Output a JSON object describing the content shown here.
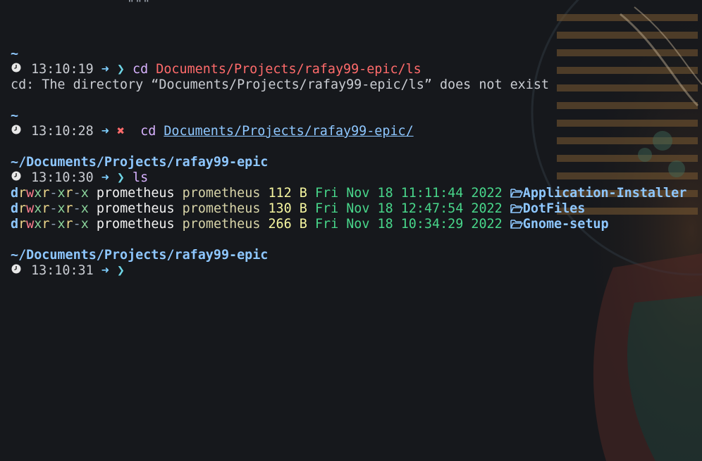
{
  "top_fragment": "\"\"\"",
  "blocks": [
    {
      "dir": "~",
      "time": "13:10:19",
      "status_ok": true,
      "command": "cd",
      "arg": "Documents/Projects/rafay99-epic/ls",
      "output": "cd: The directory “Documents/Projects/rafay99-epic/ls” does not exist"
    },
    {
      "dir": "~",
      "time": "13:10:28",
      "status_ok": false,
      "command": "cd",
      "arg": "Documents/Projects/rafay99-epic/"
    },
    {
      "dir": "~/Documents/Projects/rafay99-epic",
      "time": "13:10:30",
      "status_ok": true,
      "command": "ls",
      "listing": [
        {
          "perm": [
            "d",
            "r",
            "w",
            "x",
            "r",
            "-",
            "x",
            "r",
            "-",
            "x"
          ],
          "owner": "prometheus",
          "group": "prometheus",
          "size": "112 B",
          "date": "Fri Nov 18 11:11:44 2022",
          "name": "Application-Installer"
        },
        {
          "perm": [
            "d",
            "r",
            "w",
            "x",
            "r",
            "-",
            "x",
            "r",
            "-",
            "x"
          ],
          "owner": "prometheus",
          "group": "prometheus",
          "size": "130 B",
          "date": "Fri Nov 18 12:47:54 2022",
          "name": "DotFiles"
        },
        {
          "perm": [
            "d",
            "r",
            "w",
            "x",
            "r",
            "-",
            "x",
            "r",
            "-",
            "x"
          ],
          "owner": "prometheus",
          "group": "prometheus",
          "size": "266 B",
          "date": "Fri Nov 18 10:34:29 2022",
          "name": "Gnome-setup"
        }
      ]
    },
    {
      "dir": "~/Documents/Projects/rafay99-epic",
      "time": "13:10:31",
      "status_ok": true
    }
  ],
  "icons": {
    "clock": "clock-icon",
    "arrow": "arrow-right-icon",
    "prompt_ok": "chevron-right-icon",
    "prompt_fail": "cross-icon",
    "folder": "folder-open-icon"
  },
  "colors": {
    "background": "#16181c",
    "directory": "#8ec7ff",
    "error": "#ff6b6b",
    "command": "#d8b2ff",
    "date": "#48d68a"
  }
}
